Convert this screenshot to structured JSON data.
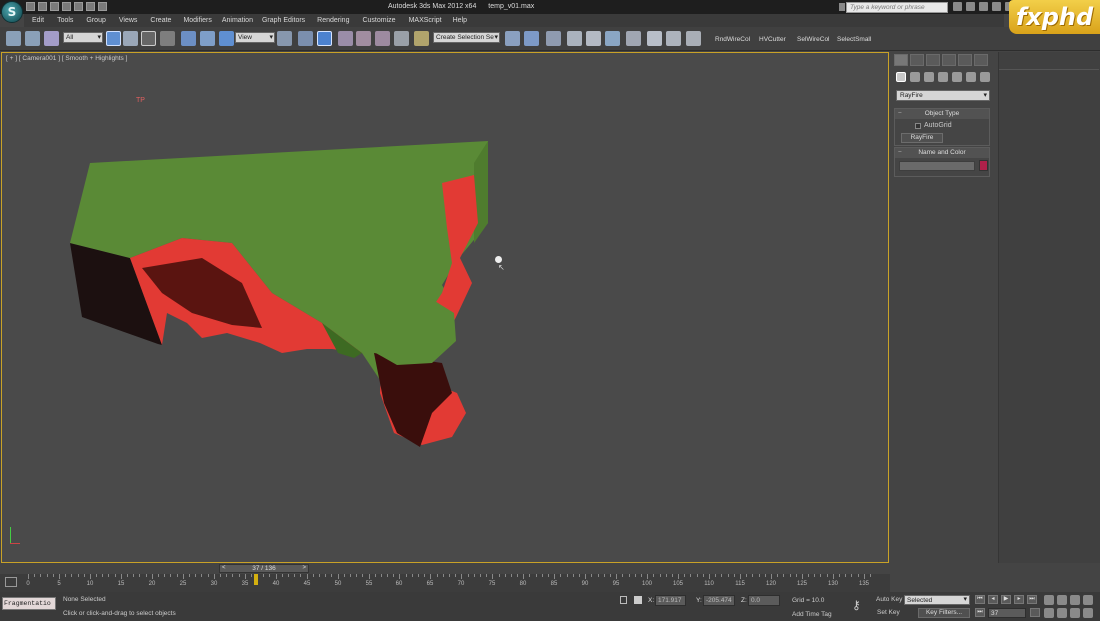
{
  "app": {
    "logo_glyph": "S",
    "title": "Autodesk 3ds Max  2012 x64",
    "filename": "temp_v01.max",
    "search_placeholder": "Type a keyword or phrase",
    "watermark": "fxphd"
  },
  "menu": [
    "Edit",
    "Tools",
    "Group",
    "Views",
    "Create",
    "Modifiers",
    "Animation",
    "Graph Editors",
    "Rendering",
    "Customize",
    "MAXScript",
    "Help"
  ],
  "toolbar": {
    "selection_filter": "All",
    "ref_coord": "View",
    "named_selection": "Create Selection Se",
    "scripts": [
      "RndWireCol",
      "HVCutter",
      "SelWireCol",
      "SelectSmall"
    ]
  },
  "viewport": {
    "label": "[ + ] [ Camera001 ] [ Smooth + Highlights ]",
    "cursor_label": "TP",
    "colors": {
      "top": "#5a8a36",
      "shell": "#e23a34",
      "inner": "#3a0e0c",
      "side": "#1c1010"
    }
  },
  "command_panel": {
    "dropdown_value": "RayFire",
    "object_type": {
      "title": "Object Type",
      "autogrid_label": "AutoGrid",
      "button_label": "RayFire"
    },
    "name_and_color": {
      "title": "Name and Color",
      "name_value": "",
      "color": "#b0214a"
    }
  },
  "timeline": {
    "current_frame": 37,
    "total_frames": 136,
    "slider_text": "37 / 136",
    "ticks": [
      0,
      5,
      10,
      15,
      20,
      25,
      30,
      35,
      40,
      45,
      50,
      55,
      60,
      65,
      70,
      75,
      80,
      85,
      90,
      95,
      100,
      105,
      110,
      115,
      120,
      125,
      130,
      135
    ]
  },
  "status": {
    "maxscript_text": "Fragmentatio",
    "selection": "None Selected",
    "prompt": "Click or click-and-drag to select objects",
    "x_label": "X:",
    "x_value": "171.917",
    "y_label": "Y:",
    "y_value": "-205.474",
    "z_label": "Z:",
    "z_value": "0.0",
    "grid": "Grid = 10.0",
    "add_time_tag": "Add Time Tag",
    "auto_key": "Auto Key",
    "set_key": "Set Key",
    "key_mode": "Selected",
    "key_filters": "Key Filters...",
    "frame_value": "37"
  }
}
